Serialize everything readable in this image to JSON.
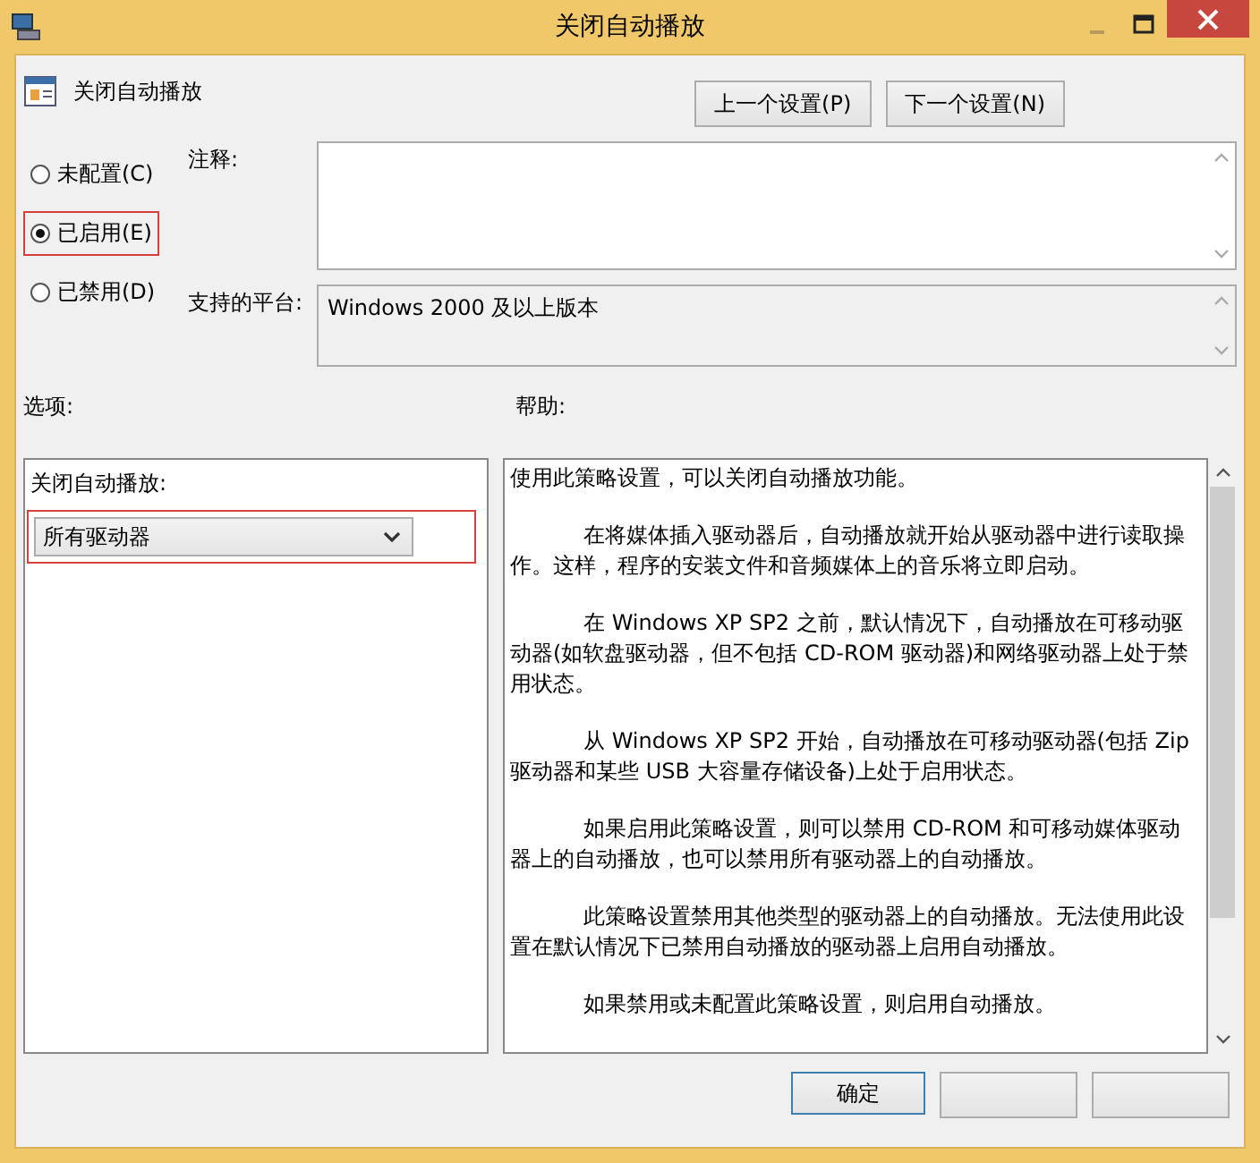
{
  "window": {
    "title": "关闭自动播放"
  },
  "policy": {
    "name": "关闭自动播放"
  },
  "nav_buttons": [
    "上一个设置(P)",
    "下一个设置(N)"
  ],
  "state_options": [
    {
      "label": "未配置(C)",
      "selected": false,
      "highlighted": false
    },
    {
      "label": "已启用(E)",
      "selected": true,
      "highlighted": true
    },
    {
      "label": "已禁用(D)",
      "selected": false,
      "highlighted": false
    }
  ],
  "comment": {
    "label": "注释:"
  },
  "platform": {
    "label": "支持的平台:",
    "value": "Windows 2000 及以上版本"
  },
  "options": {
    "heading": "选项:",
    "field_label": "关闭自动播放:",
    "dropdown_value": "所有驱动器",
    "highlighted": true
  },
  "help": {
    "heading": "帮助:",
    "paragraphs": [
      {
        "text": "使用此策略设置，可以关闭自动播放功能。",
        "indented": false
      },
      {
        "text": "在将媒体插入驱动器后，自动播放就开始从驱动器中进行读取操作。这样，程序的安装文件和音频媒体上的音乐将立即启动。",
        "indented": true
      },
      {
        "text": "在 Windows XP SP2 之前，默认情况下，自动播放在可移动驱动器(如软盘驱动器，但不包括 CD-ROM 驱动器)和网络驱动器上处于禁用状态。",
        "indented": true
      },
      {
        "text": "从 Windows XP SP2 开始，自动播放在可移动驱动器(包括 Zip 驱动器和某些 USB 大容量存储设备)上处于启用状态。",
        "indented": true
      },
      {
        "text": "如果启用此策略设置，则可以禁用 CD-ROM 和可移动媒体驱动器上的自动播放，也可以禁用所有驱动器上的自动播放。",
        "indented": true
      },
      {
        "text": "此策略设置禁用其他类型的驱动器上的自动播放。无法使用此设置在默认情况下已禁用自动播放的驱动器上启用自动播放。",
        "indented": true
      },
      {
        "text": "如果禁用或未配置此策略设置，则启用自动播放。",
        "indented": true
      }
    ]
  },
  "footer_buttons": [
    "确定"
  ]
}
